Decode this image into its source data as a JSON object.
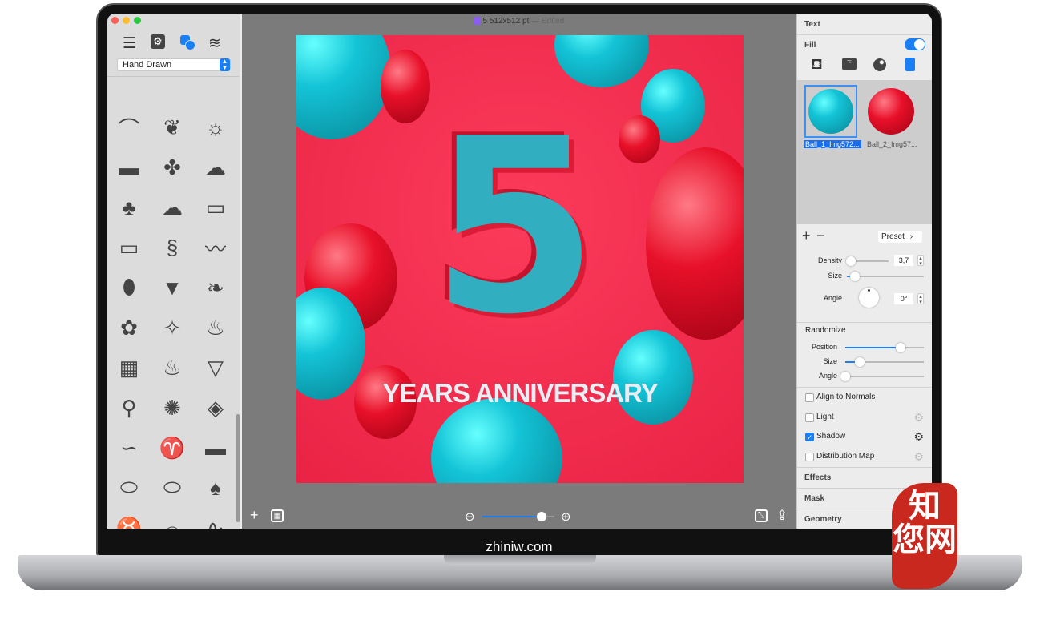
{
  "window": {
    "title": "5 512x512 pt",
    "status": "— Edited",
    "doc_icon": "document-icon"
  },
  "left_panel": {
    "toolbar": [
      "list-icon",
      "gear-icon",
      "shapes-icon",
      "layers-icon"
    ],
    "category": "Hand Drawn",
    "shapes": [
      "ribbon",
      "floral",
      "sunburst",
      "banner",
      "branch",
      "cloud-badge",
      "tree",
      "cloud",
      "frame",
      "speech-bubble",
      "swirl",
      "ribbon-2",
      "label",
      "ice-cream",
      "leaf",
      "flower",
      "candy",
      "cupcake",
      "stamp",
      "cupcake-2",
      "ice-cream-2",
      "bicycle",
      "scribble",
      "diamond-burst",
      "swirl-2",
      "cherries",
      "ribbon-3",
      "oval-badge",
      "oval-badge-2",
      "tree-2",
      "sock",
      "pennant",
      "brush-stroke"
    ]
  },
  "canvas": {
    "headline": "YEARS ANNIVERSARY",
    "number": "5",
    "colors": {
      "background": "#f02a4b",
      "balloon_teal": "#13c4d6",
      "balloon_red": "#e8102a"
    }
  },
  "bottom_bar": {
    "zoom_level": 0.82
  },
  "right_panel": {
    "text_section": "Text",
    "fill_label": "Fill",
    "fill_on": true,
    "fill_types": [
      "paint-bucket-icon",
      "wave-pattern-icon",
      "sphere-icon",
      "spray-can-icon"
    ],
    "materials": [
      {
        "name": "Ball_1_Img572...",
        "selected": true
      },
      {
        "name": "Ball_2_Img57...",
        "selected": false
      }
    ],
    "preset_label": "Preset",
    "density": {
      "label": "Density",
      "value": "3,7",
      "level": 0.1
    },
    "size": {
      "label": "Size",
      "level": 0.1
    },
    "angle": {
      "label": "Angle",
      "value": "0°"
    },
    "randomize": {
      "title": "Randomize",
      "position": {
        "label": "Position",
        "level": 0.7
      },
      "size": {
        "label": "Size",
        "level": 0.18
      },
      "angle": {
        "label": "Angle",
        "level": 0.0
      }
    },
    "options": [
      {
        "label": "Align to Normals",
        "checked": false
      },
      {
        "label": "Light",
        "checked": false
      },
      {
        "label": "Shadow",
        "checked": true
      },
      {
        "label": "Distribution Map",
        "checked": false
      }
    ],
    "sections": [
      "Effects",
      "Mask",
      "Geometry"
    ]
  },
  "device": {
    "chin_label": "zhiniw.com",
    "seal_text": "知您网"
  }
}
